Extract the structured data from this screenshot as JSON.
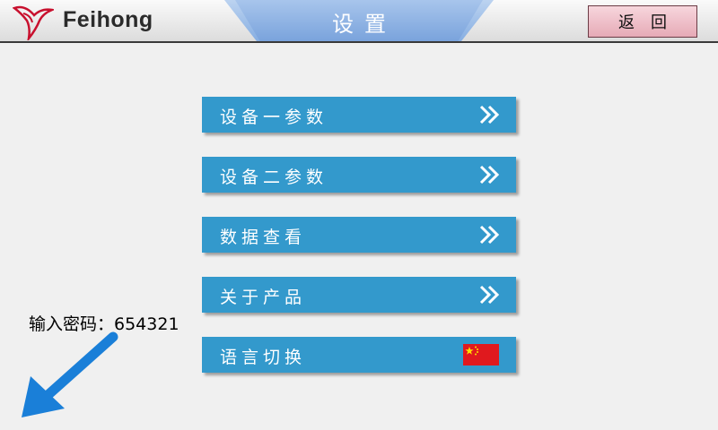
{
  "header": {
    "logo_text": "Feihong",
    "title": "设置",
    "back_label": "返回"
  },
  "menu": {
    "items": [
      {
        "label": "设备一参数",
        "icon": "double-chevron-right-icon"
      },
      {
        "label": "设备二参数",
        "icon": "double-chevron-right-icon"
      },
      {
        "label": "数据查看",
        "icon": "double-chevron-right-icon"
      },
      {
        "label": "关于产品",
        "icon": "double-chevron-right-icon"
      },
      {
        "label": "语言切换",
        "icon": "china-flag-icon"
      }
    ]
  },
  "annotation": {
    "password_text": "输入密码：654321",
    "arrow_icon": "arrow-down-left-icon"
  },
  "colors": {
    "menu_button": "#3399cc",
    "title_tab": "#86aee2",
    "back_button": "#e6aab6",
    "annotation_arrow": "#1a7fd8"
  }
}
